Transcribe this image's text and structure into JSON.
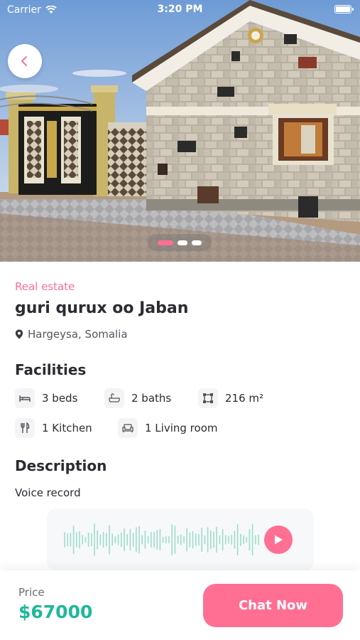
{
  "status_bar": {
    "carrier": "Carrier",
    "time": "3:20 PM"
  },
  "gallery": {
    "slide_count": 3,
    "active_index": 0
  },
  "listing": {
    "category": "Real estate",
    "title": "guri qurux oo Jaban",
    "location": "Hargeysa, Somalia"
  },
  "facilities": {
    "heading": "Facilities",
    "items": [
      {
        "icon": "bed-icon",
        "label": "3 beds"
      },
      {
        "icon": "bathtub-icon",
        "label": "2 baths"
      },
      {
        "icon": "area-icon",
        "label": "216 m²"
      },
      {
        "icon": "kitchen-utensils-icon",
        "label": "1 Kitchen"
      },
      {
        "icon": "sofa-icon",
        "label": "1 Living room"
      }
    ]
  },
  "description": {
    "heading": "Description",
    "voice_label": "Voice record"
  },
  "footer": {
    "price_label": "Price",
    "price_value": "$67000",
    "chat_button": "Chat Now"
  },
  "colors": {
    "accent": "#ff6f93",
    "price": "#1eb89a",
    "waveform": "#9fdccd"
  }
}
